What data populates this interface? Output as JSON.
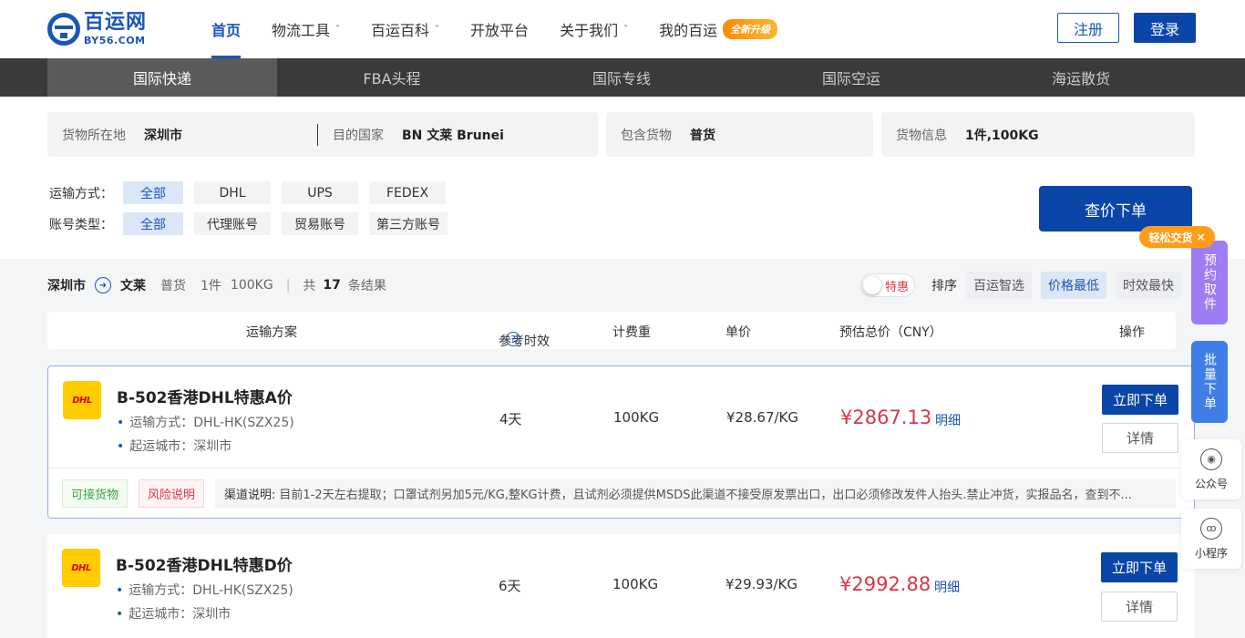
{
  "header": {
    "logo_cn": "百运网",
    "logo_en": "BY56.COM",
    "nav": [
      {
        "label": "首页",
        "active": true,
        "chevron": false
      },
      {
        "label": "物流工具",
        "chevron": true
      },
      {
        "label": "百运百科",
        "chevron": true
      },
      {
        "label": "开放平台",
        "chevron": false
      },
      {
        "label": "关于我们",
        "chevron": true
      },
      {
        "label": "我的百运",
        "chevron": false
      }
    ],
    "upgrade_badge": "全新升级",
    "register": "注册",
    "login": "登录"
  },
  "tabs": [
    "国际快递",
    "FBA头程",
    "国际专线",
    "国际空运",
    "海运散货"
  ],
  "search": {
    "origin_label": "货物所在地",
    "origin_value": "深圳市",
    "dest_label": "目的国家",
    "dest_value": "BN 文莱 Brunei",
    "goods_label": "包含货物",
    "goods_value": "普货",
    "info_label": "货物信息",
    "info_value": "1件,100KG",
    "ship_label": "运输方式：",
    "ship_chips": [
      "全部",
      "DHL",
      "UPS",
      "FEDEX"
    ],
    "acct_label": "账号类型：",
    "acct_chips": [
      "全部",
      "代理账号",
      "贸易账号",
      "第三方账号"
    ],
    "query_button": "查价下单"
  },
  "summary": {
    "from": "深圳市",
    "to": "文莱",
    "goods": "普货",
    "qty": "1件",
    "weight": "100KG",
    "total_prefix": "共",
    "count": "17",
    "total_suffix": "条结果"
  },
  "sort": {
    "special_toggle": "特惠",
    "label": "排序",
    "options": [
      "百运智选",
      "价格最低",
      "时效最快"
    ],
    "active": "价格最低"
  },
  "columns": {
    "plan": "运输方案",
    "time": "参考时效",
    "weight": "计费重",
    "unit_price": "单价",
    "total": "预估总价（CNY）",
    "action": "操作"
  },
  "results": [
    {
      "carrier": "DHL",
      "title": "B-502香港DHL特惠A价",
      "method": "运输方式：DHL-HK(SZX25)",
      "city": "起运城市：深圳市",
      "time": "4天",
      "weight": "100KG",
      "unit_price": "¥28.67/KG",
      "total": "¥2867.13",
      "detail_link": "明细",
      "order_btn": "立即下单",
      "detail_btn": "详情",
      "tag_ok": "可接货物",
      "tag_risk": "风险说明",
      "note_label": "渠道说明:",
      "note": "目前1-2天左右提取；口罩试剂另加5元/KG,整KG计费，且试剂必须提供MSDS此渠道不接受原发票出口，出口必须修改发件人抬头.禁止冲货，实报品名，查到不..."
    },
    {
      "carrier": "DHL",
      "title": "B-502香港DHL特惠D价",
      "method": "运输方式：DHL-HK(SZX25)",
      "city": "起运城市：深圳市",
      "time": "6天",
      "weight": "100KG",
      "unit_price": "¥29.93/KG",
      "total": "¥2992.88",
      "detail_link": "明细",
      "order_btn": "立即下单",
      "detail_btn": "详情"
    }
  ],
  "floating": {
    "easy_tag": "轻松交货",
    "close_icon": "×",
    "book": "预约取件",
    "batch": "批量下单",
    "wechat": "公众号",
    "mini": "小程序"
  },
  "colors": {
    "brand": "#1a56b8",
    "price_red": "#d9364a",
    "tab_bar": "#3a3a3a",
    "dhl_yellow": "#ffcc00"
  }
}
